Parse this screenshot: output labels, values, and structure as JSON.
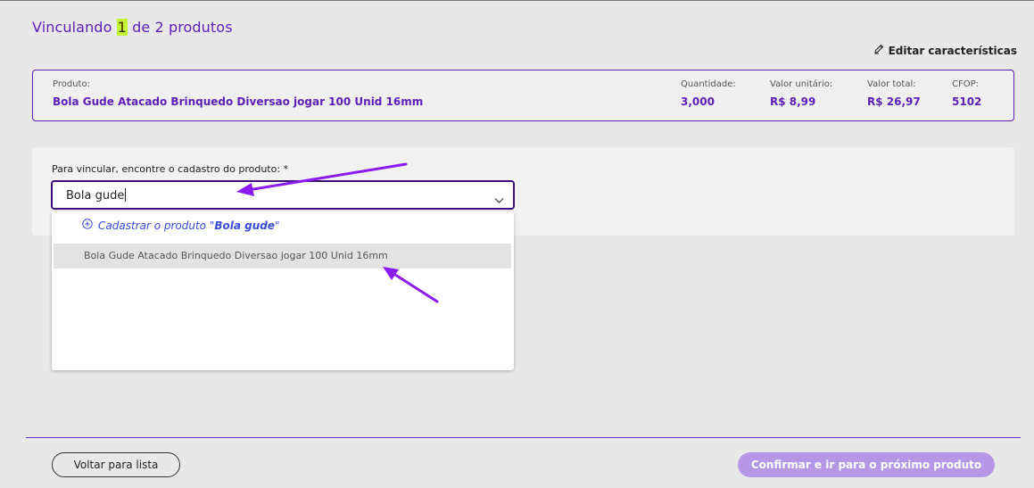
{
  "header": {
    "title_prefix": "Vinculando ",
    "title_current": "1",
    "title_suffix": " de 2 produtos",
    "edit_label": "Editar características"
  },
  "product": {
    "name_label": "Produto:",
    "name": "Bola Gude Atacado Brinquedo Diversao jogar 100 Unid 16mm",
    "quantity_label": "Quantidade:",
    "quantity": "3,000",
    "unit_price_label": "Valor unitário:",
    "unit_price": "R$ 8,99",
    "total_label": "Valor total:",
    "total": "R$ 26,97",
    "cfop_label": "CFOP:",
    "cfop": "5102"
  },
  "search": {
    "label": "Para vincular, encontre o cadastro do produto: *",
    "value": "Bola gude",
    "create_prefix": "Cadastrar o produto \"",
    "create_term": "Bola gude",
    "create_suffix": "\"",
    "results": [
      "Bola Gude Atacado Brinquedo Diversao jogar 100 Unid 16mm"
    ]
  },
  "footer": {
    "back_label": "Voltar para lista",
    "confirm_label": "Confirmar e ir para o próximo produto"
  },
  "colors": {
    "accent": "#5b1fb5",
    "highlight": "#c6f432",
    "arrow": "#8a1cf0",
    "confirm_disabled": "#b697e6"
  }
}
